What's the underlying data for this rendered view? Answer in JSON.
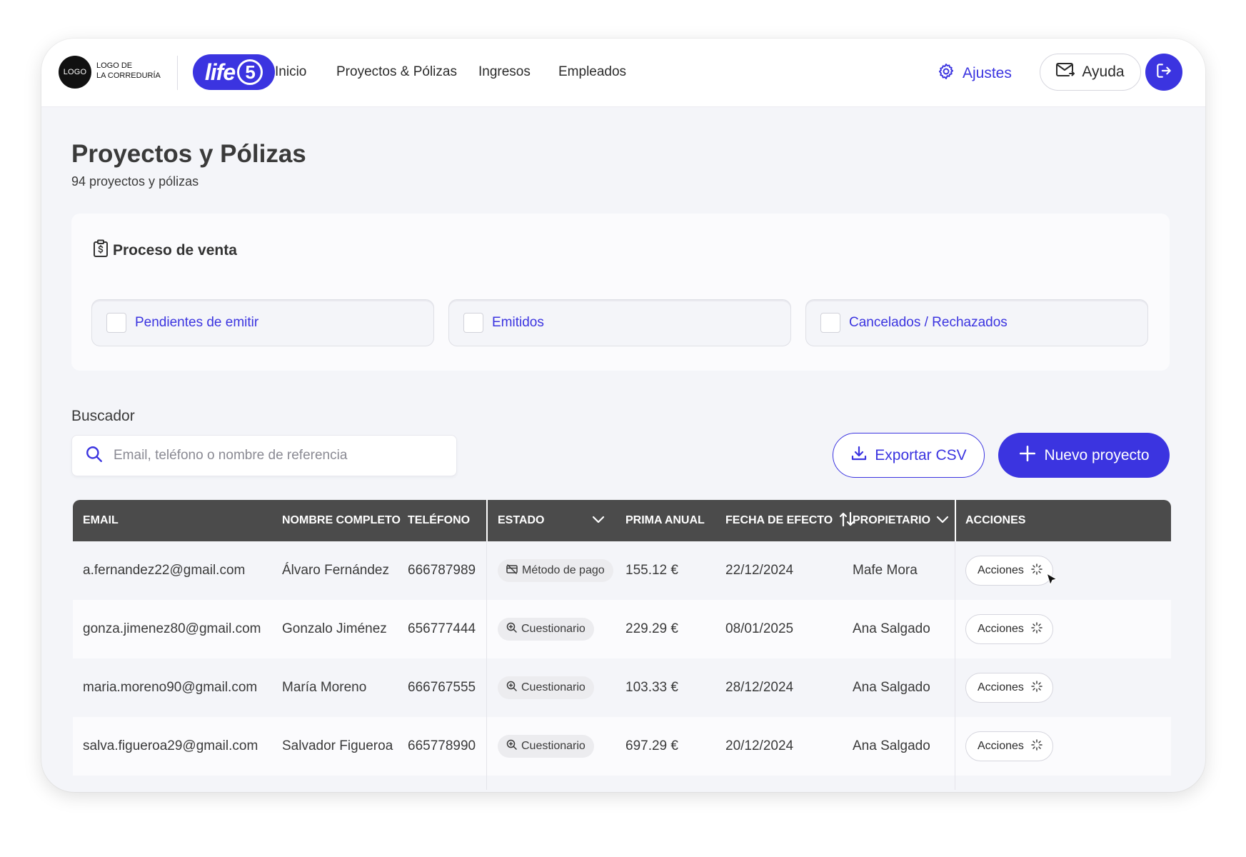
{
  "header": {
    "logo_mark": "LOGO",
    "logo_line1": "LOGO DE",
    "logo_line2": "LA CORREDURÍA",
    "brand_text": "life",
    "brand_number": "5",
    "nav": [
      "Inicio",
      "Proyectos & Pólizas",
      "Ingresos",
      "Empleados"
    ],
    "settings_label": "Ajustes",
    "help_label": "Ayuda"
  },
  "page": {
    "title": "Proyectos y Pólizas",
    "subtitle": "94 proyectos y pólizas"
  },
  "sales_process": {
    "title": "Proceso de venta",
    "filters": [
      "Pendientes de emitir",
      "Emitidos",
      "Cancelados / Rechazados"
    ]
  },
  "search": {
    "label": "Buscador",
    "placeholder": "Email, teléfono o nombre de referencia"
  },
  "toolbar": {
    "export_label": "Exportar CSV",
    "new_label": "Nuevo proyecto"
  },
  "table": {
    "columns": [
      "EMAIL",
      "NOMBRE COMPLETO",
      "TELÉFONO",
      "ESTADO",
      "PRIMA ANUAL",
      "FECHA DE EFECTO",
      "PROPIETARIO",
      "ACCIONES"
    ],
    "rows": [
      {
        "email": "a.fernandez22@gmail.com",
        "name": "Álvaro Fernández",
        "phone": "666787989",
        "status": "Método de pago",
        "status_icon": "card-off-icon",
        "premium": "155.12 €",
        "date": "22/12/2024",
        "owner": "Mafe Mora",
        "action": "Acciones"
      },
      {
        "email": "gonza.jimenez80@gmail.com",
        "name": "Gonzalo Jiménez",
        "phone": "656777444",
        "status": "Cuestionario",
        "status_icon": "search-doc-icon",
        "premium": "229.29 €",
        "date": "08/01/2025",
        "owner": "Ana Salgado",
        "action": "Acciones"
      },
      {
        "email": "maria.moreno90@gmail.com",
        "name": "María Moreno",
        "phone": "666767555",
        "status": "Cuestionario",
        "status_icon": "search-doc-icon",
        "premium": "103.33 €",
        "date": "28/12/2024",
        "owner": "Ana Salgado",
        "action": "Acciones"
      },
      {
        "email": "salva.figueroa29@gmail.com",
        "name": "Salvador Figueroa",
        "phone": "665778990",
        "status": "Cuestionario",
        "status_icon": "search-doc-icon",
        "premium": "697.29 €",
        "date": "20/12/2024",
        "owner": "Ana Salgado",
        "action": "Acciones"
      }
    ]
  },
  "colors": {
    "accent": "#3b34e0",
    "header_bg": "#4b4b4b",
    "page_bg": "#f4f5f9"
  }
}
